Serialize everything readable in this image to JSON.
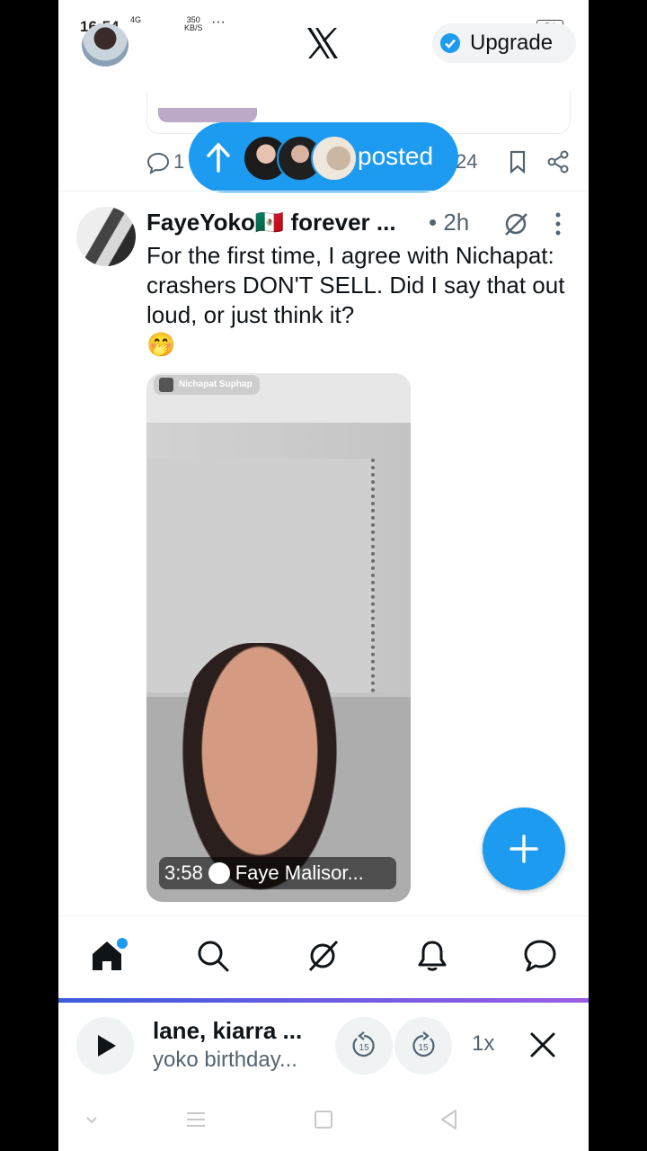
{
  "status_bar": {
    "time": "16:54",
    "network": "4G",
    "speed_value": "350",
    "speed_unit": "KB/S",
    "more": "···",
    "battery": "54"
  },
  "header": {
    "logo": "x-logo",
    "upgrade_label": "Upgrade"
  },
  "previous_tweet": {
    "reply_count": "1",
    "views_suffix": "24"
  },
  "new_posts_pill": {
    "label": "posted"
  },
  "tweet": {
    "author": "FayeYoko🇲🇽 forever ...",
    "time": "• 2h",
    "text": "For the first time, I agree with Nichapat: crashers DON'T SELL. Did I say that out loud, or just think it?\n   🤭",
    "media": {
      "badge": "Nichapat Suphap",
      "duration": "3:58",
      "source": "Faye Malisor..."
    }
  },
  "bottom_nav": {
    "items": [
      "home-icon",
      "search-icon",
      "grok-icon",
      "notifications-icon",
      "messages-icon"
    ]
  },
  "player": {
    "title": "lane, kiarra ...",
    "subtitle": "yoko birthday...",
    "skip_back": "15",
    "skip_forward": "15",
    "speed": "1x"
  },
  "colors": {
    "accent": "#1d9bf0",
    "text": "#0f1419",
    "secondary": "#536471"
  }
}
